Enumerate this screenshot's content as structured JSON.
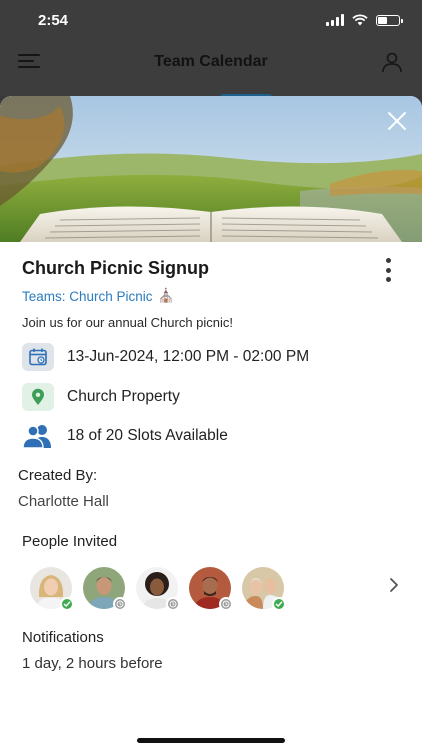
{
  "status_bar": {
    "time": "2:54"
  },
  "nav_bar": {
    "title": "Team Calendar",
    "menu_icon": "menu-icon",
    "profile_icon": "profile-icon"
  },
  "event": {
    "title": "Church Picnic Signup",
    "teams_link": "Teams: Church Picnic",
    "team_emoji": "⛪",
    "description": "Join us for our annual Church picnic!",
    "date_time": "13-Jun-2024, 12:00 PM - 02:00 PM",
    "location": "Church Property",
    "slots": "18 of 20 Slots Available",
    "created_by_label": "Created By:",
    "created_by": "Charlotte Hall",
    "people_invited_label": "People Invited",
    "invitees": [
      {
        "status": "accepted",
        "status_icon": "check-icon"
      },
      {
        "status": "pending",
        "status_icon": "clock-icon"
      },
      {
        "status": "pending",
        "status_icon": "clock-icon"
      },
      {
        "status": "pending",
        "status_icon": "clock-icon"
      },
      {
        "status": "accepted",
        "status_icon": "check-icon"
      }
    ],
    "notifications_label": "Notifications",
    "notifications_value": "1 day, 2 hours before"
  },
  "colors": {
    "link": "#2b7bbf",
    "accepted": "#3eab4f",
    "pending": "#9a9a9a",
    "calendar_icon_bg": "#dfe3ea",
    "location_icon_bg": "#e2f1e6",
    "location_icon": "#3e9e56",
    "people_icon": "#2f6fb5"
  }
}
